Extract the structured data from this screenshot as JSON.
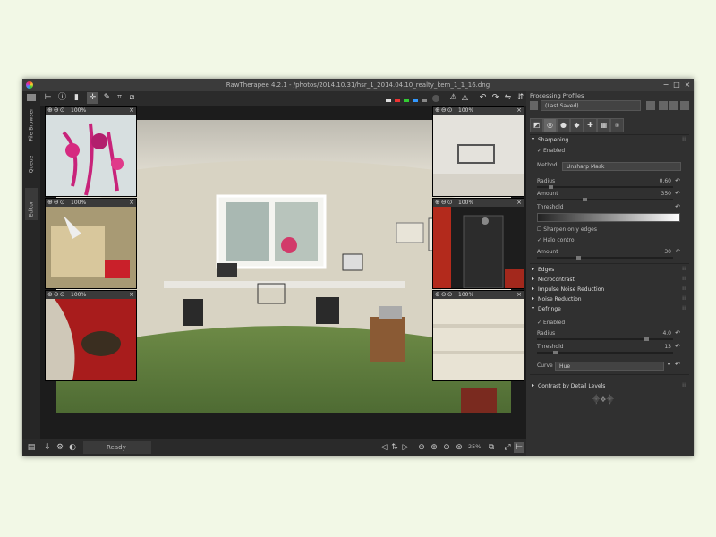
{
  "window": {
    "title": "RawTherapee 4.2.1 - /photos/2014.10.31/hsr_1_2014.04.10_realty_kem_1_1_16.dng",
    "colors": {
      "bg": "#2e2e2e",
      "titlebar": "#3b3b3b",
      "panel": "#303030",
      "accent": "#e8e8e8"
    }
  },
  "left_tabs": {
    "file_browser": "File Browser",
    "queue": "Queue",
    "editor": "Editor"
  },
  "toolbar": {
    "icons": [
      "hand-icon",
      "info-icon",
      "before-after-icon",
      "crosshair-icon",
      "color-picker-icon",
      "crop-icon",
      "straighten-icon"
    ],
    "right_icons": [
      "warning-icon",
      "warning-outline-icon",
      "rotate-left-icon",
      "rotate-right-icon",
      "flip-h-icon",
      "flip-v-icon",
      "top-icon"
    ]
  },
  "detail_windows": [
    {
      "zoom": "100%"
    },
    {
      "zoom": "100%"
    },
    {
      "zoom": "100%"
    },
    {
      "zoom": "100%"
    },
    {
      "zoom": "100%"
    },
    {
      "zoom": "100%"
    }
  ],
  "statusbar": {
    "status": "Ready",
    "zoom": "25%"
  },
  "right_panel": {
    "title": "Processing Profiles",
    "profile": "(Last Saved)",
    "sections": {
      "sharpening": "Sharpening",
      "edges": "Edges",
      "microcontrast": "Microcontrast",
      "impulse_nr": "Impulse Noise Reduction",
      "noise_reduction": "Noise Reduction",
      "defringe": "Defringe",
      "contrast_detail": "Contrast by Detail Levels"
    },
    "sharpening": {
      "enabled": "Enabled",
      "method_label": "Method",
      "method_value": "Unsharp Mask",
      "radius_label": "Radius",
      "radius_value": "0.60",
      "radius_frac": 0.1,
      "amount_label": "Amount",
      "amount_value": "350",
      "amount_frac": 0.35,
      "threshold_label": "Threshold",
      "sharpen_only_edges": "Sharpen only edges",
      "halo_control": "Halo control",
      "halo_amount_label": "Amount",
      "halo_amount_value": "30",
      "halo_amount_frac": 0.3
    },
    "defringe": {
      "enabled": "Enabled",
      "radius_label": "Radius",
      "radius_value": "4.0",
      "radius_frac": 0.8,
      "threshold_label": "Threshold",
      "threshold_value": "13",
      "threshold_frac": 0.13,
      "curve_label": "Curve",
      "curve_value": "Hue"
    }
  }
}
